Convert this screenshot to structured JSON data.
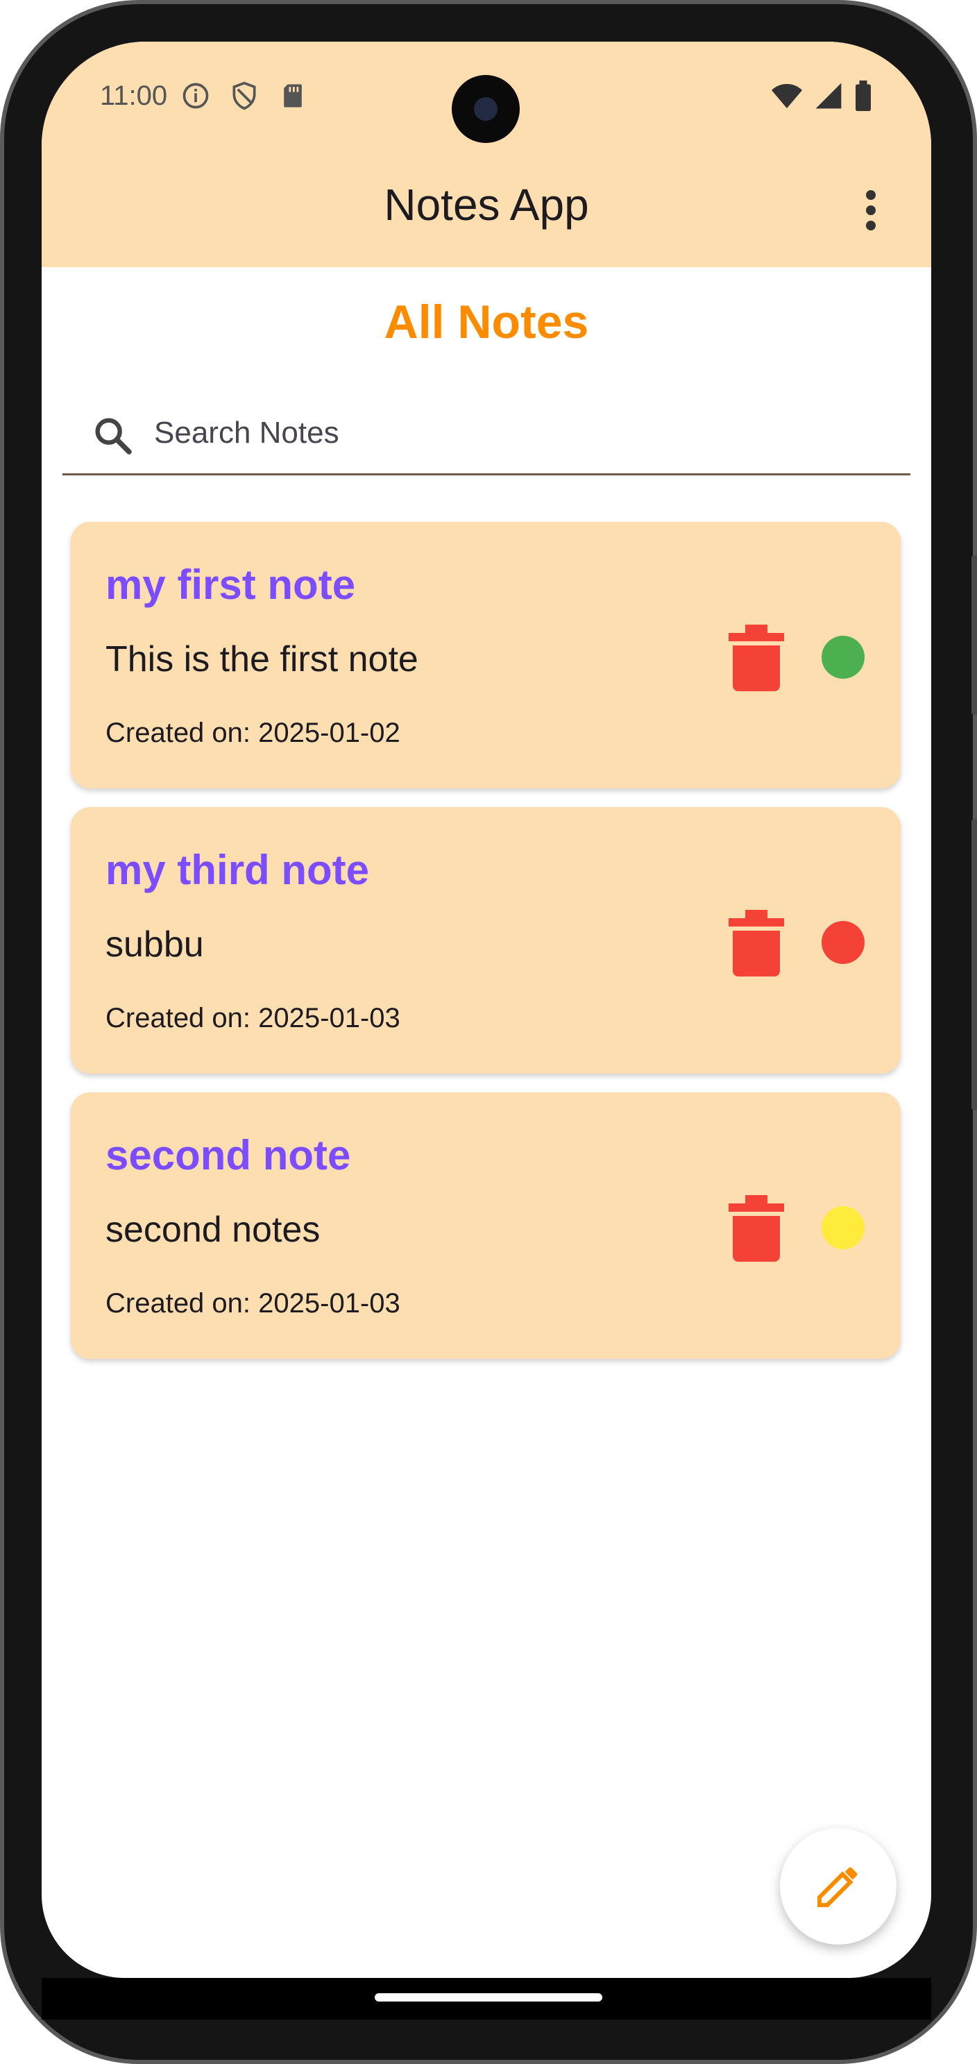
{
  "status_bar": {
    "time": "11:00"
  },
  "app_bar": {
    "title": "Notes App"
  },
  "main": {
    "heading": "All Notes",
    "search": {
      "placeholder": "Search Notes",
      "value": ""
    }
  },
  "notes": [
    {
      "title": "my first note",
      "body": "This is the first note",
      "created": "Created on: 2025-01-02",
      "status_color": "#4caf50"
    },
    {
      "title": "my third note",
      "body": "subbu",
      "created": "Created on: 2025-01-03",
      "status_color": "#f44336"
    },
    {
      "title": "second note",
      "body": "second notes",
      "created": "Created on: 2025-01-03",
      "status_color": "#ffeb3b"
    }
  ],
  "colors": {
    "app_bar_bg": "#fcdeb0",
    "heading": "#fb8c00",
    "note_title": "#7c4dff",
    "delete_icon": "#f44336",
    "fab_icon": "#fb8c00"
  },
  "icons": {
    "search": "search-icon",
    "more": "more-vert-icon",
    "delete": "trash-icon",
    "fab": "pencil-icon"
  }
}
